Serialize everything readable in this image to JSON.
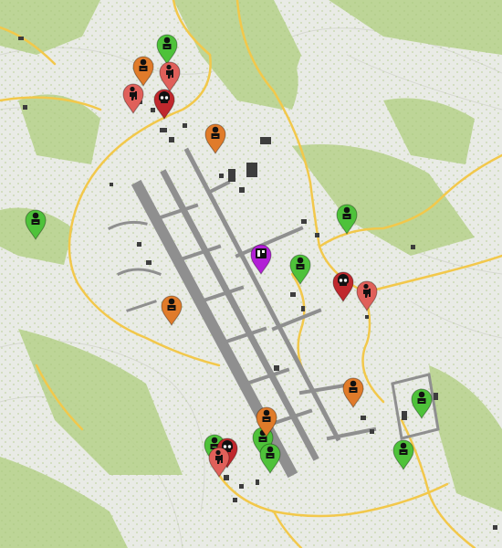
{
  "map": {
    "colors": {
      "background": "#e9ebe6",
      "forest": "#a9c77c",
      "forest_light": "#c3d8a0",
      "road": "#f2c84b",
      "runway": "#8f8f8f",
      "building": "#3d3d3d",
      "contour": "#d2d4ce"
    }
  },
  "legend_colors": {
    "green": "#4ec23a",
    "orange": "#e07b2a",
    "red": "#e0605a",
    "darkred": "#c0282d",
    "purple": "#b21fd6"
  },
  "markers": [
    {
      "type": "soldier",
      "color": "green",
      "icon": "soldier-icon"
    },
    {
      "type": "soldier",
      "color": "orange",
      "icon": "soldier-icon"
    },
    {
      "type": "hunter",
      "color": "red",
      "icon": "hunter-icon"
    },
    {
      "type": "hunter",
      "color": "red",
      "icon": "hunter-icon"
    },
    {
      "type": "skull",
      "color": "darkred",
      "icon": "skull-icon"
    },
    {
      "type": "soldier",
      "color": "orange",
      "icon": "soldier-icon"
    },
    {
      "type": "soldier",
      "color": "green",
      "icon": "soldier-icon"
    },
    {
      "type": "soldier",
      "color": "green",
      "icon": "soldier-icon"
    },
    {
      "type": "trader",
      "color": "purple",
      "icon": "trader-icon"
    },
    {
      "type": "soldier",
      "color": "green",
      "icon": "soldier-icon"
    },
    {
      "type": "skull",
      "color": "darkred",
      "icon": "skull-icon"
    },
    {
      "type": "hunter",
      "color": "red",
      "icon": "hunter-icon"
    },
    {
      "type": "soldier",
      "color": "orange",
      "icon": "soldier-icon"
    },
    {
      "type": "soldier",
      "color": "orange",
      "icon": "soldier-icon"
    },
    {
      "type": "soldier",
      "color": "green",
      "icon": "soldier-icon"
    },
    {
      "type": "soldier",
      "color": "green",
      "icon": "soldier-icon"
    },
    {
      "type": "soldier",
      "color": "green",
      "icon": "soldier-icon"
    },
    {
      "type": "skull",
      "color": "darkred",
      "icon": "skull-icon"
    },
    {
      "type": "hunter",
      "color": "red",
      "icon": "hunter-icon"
    },
    {
      "type": "soldier",
      "color": "orange",
      "icon": "soldier-icon"
    },
    {
      "type": "soldier",
      "color": "green",
      "icon": "soldier-icon"
    },
    {
      "type": "soldier",
      "color": "green",
      "icon": "soldier-icon"
    }
  ]
}
